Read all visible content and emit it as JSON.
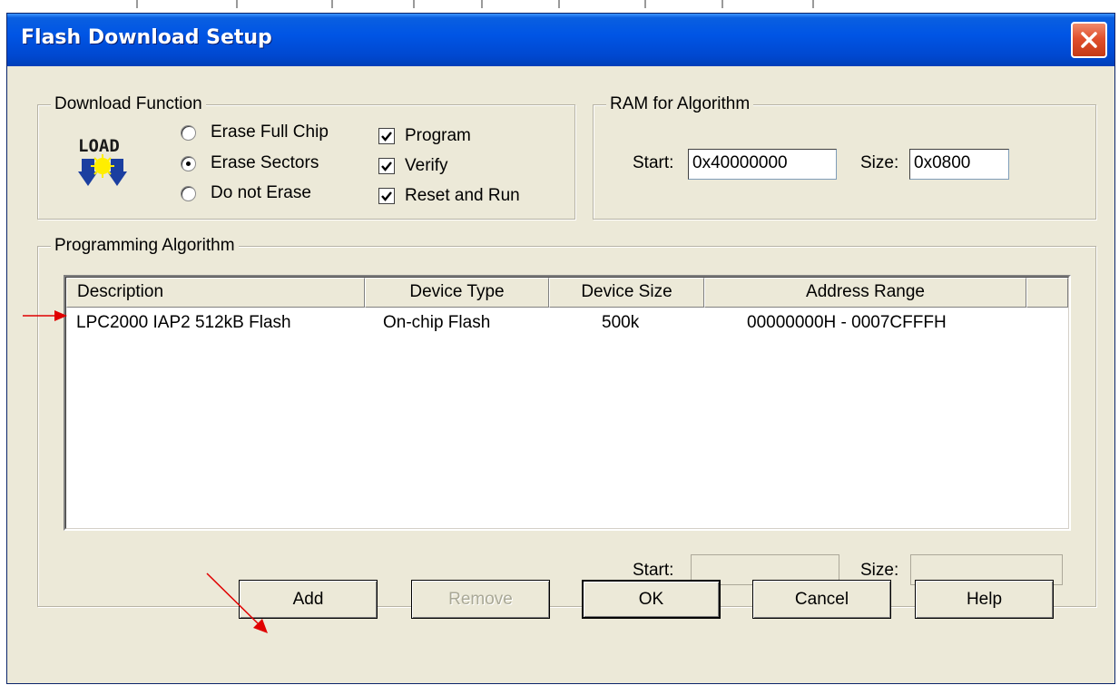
{
  "window": {
    "title": "Flash Download Setup"
  },
  "download_function": {
    "legend": "Download Function",
    "icon_text": "LOAD",
    "radios": [
      {
        "label": "Erase Full Chip",
        "selected": false
      },
      {
        "label": "Erase Sectors",
        "selected": true
      },
      {
        "label": "Do not Erase",
        "selected": false
      }
    ],
    "checkboxes": [
      {
        "label": "Program",
        "checked": true
      },
      {
        "label": "Verify",
        "checked": true
      },
      {
        "label": "Reset and Run",
        "checked": true
      }
    ]
  },
  "ram": {
    "legend": "RAM for Algorithm",
    "start_label": "Start:",
    "start_value": "0x40000000",
    "size_label": "Size:",
    "size_value": "0x0800"
  },
  "programming": {
    "legend": "Programming Algorithm",
    "columns": [
      "Description",
      "Device Type",
      "Device Size",
      "Address Range"
    ],
    "rows": [
      [
        "LPC2000 IAP2 512kB Flash",
        "On-chip Flash",
        "500k",
        "00000000H - 0007CFFFH"
      ]
    ],
    "start_label": "Start:",
    "start_value": "",
    "size_label": "Size:",
    "size_value": ""
  },
  "buttons": {
    "add": "Add",
    "remove": "Remove",
    "ok": "OK",
    "cancel": "Cancel",
    "help": "Help"
  },
  "colors": {
    "titlebar": "#0055e5",
    "dialog_bg": "#ece9d8",
    "close_button": "#e0502e",
    "annotation_arrow": "#e00000"
  },
  "icons": [
    "close-icon",
    "load-icon",
    "annotation-arrow"
  ]
}
